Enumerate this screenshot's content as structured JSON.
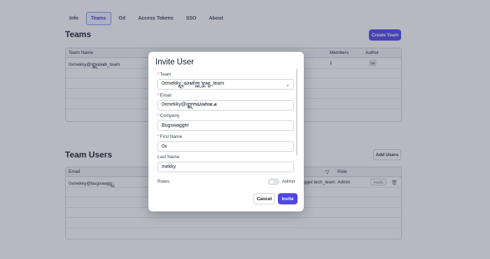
{
  "tabs": [
    {
      "label": "Info"
    },
    {
      "label": "Teams"
    },
    {
      "label": "Git"
    },
    {
      "label": "Access Tokens"
    },
    {
      "label": "SSO"
    },
    {
      "label": "About"
    }
  ],
  "teams": {
    "title": "Teams",
    "create_label": "Create Team",
    "columns": [
      "Team Name",
      "Members",
      "Author"
    ],
    "rows": [
      {
        "team_name": "0xmekky@ꦆ꧀ꦏꦱꦁꦏꦁ_team",
        "members": "1",
        "author": "0M"
      }
    ]
  },
  "team_users": {
    "title": "Team Users",
    "add_label": "Add Users",
    "columns": [
      "Email",
      "Role"
    ],
    "rows": [
      {
        "email": "0xmekky@bugswagg꧀ꦫ",
        "team": "gger.tech_team",
        "role": "Admin",
        "modify_label": "Modify"
      }
    ]
  },
  "modal": {
    "title": "Invite User",
    "team_label": "Team",
    "team_value": "0xmekky꧀ꦆꦱꦁꦏꦂꦒ꧀ꦏꦫ꧀ꦧꦤ꧀ꦗ_team",
    "email_label": "Email",
    "email_value": "0xmekky@ꦆ꧀ꦏꦒꦱꦁꦏꦁꦗ꧀ꦱ",
    "company_label": "Company",
    "company_value": "Bugswagger",
    "first_name_label": "First Name",
    "first_name_value": "0x",
    "last_name_label": "Last Name",
    "last_name_value": "mekky",
    "roles_label": "Roles:",
    "admin_label": "Admin",
    "admin_enabled": false,
    "cancel_label": "Cancel",
    "invite_label": "Invite"
  },
  "colors": {
    "primary": "#4f46e5",
    "overlay": "rgba(60,66,90,0.37)",
    "required": "#ef4444"
  }
}
